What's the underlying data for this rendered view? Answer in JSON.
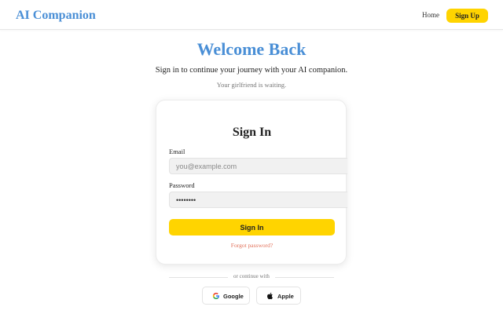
{
  "nav": {
    "brand": "AI Companion",
    "home_label": "Home",
    "signup_label": "Sign Up"
  },
  "hero": {
    "title": "Welcome Back",
    "subtitle": "Sign in to continue your journey with your AI companion.",
    "note": "Your girlfriend is waiting."
  },
  "form": {
    "title": "Sign In",
    "email_label": "Email",
    "email_placeholder": "you@example.com",
    "password_label": "Password",
    "password_value": "password",
    "submit_label": "Sign In",
    "forgot_label": "Forgot password?"
  },
  "social": {
    "divider_text": "or continue with",
    "google_label": "Google",
    "google_icon": "google-icon",
    "apple_label": "Apple",
    "apple_icon": "apple-icon"
  },
  "colors": {
    "accent_blue": "#4a8fd6",
    "button_yellow": "#ffd400",
    "link_coral": "#e2735c"
  }
}
